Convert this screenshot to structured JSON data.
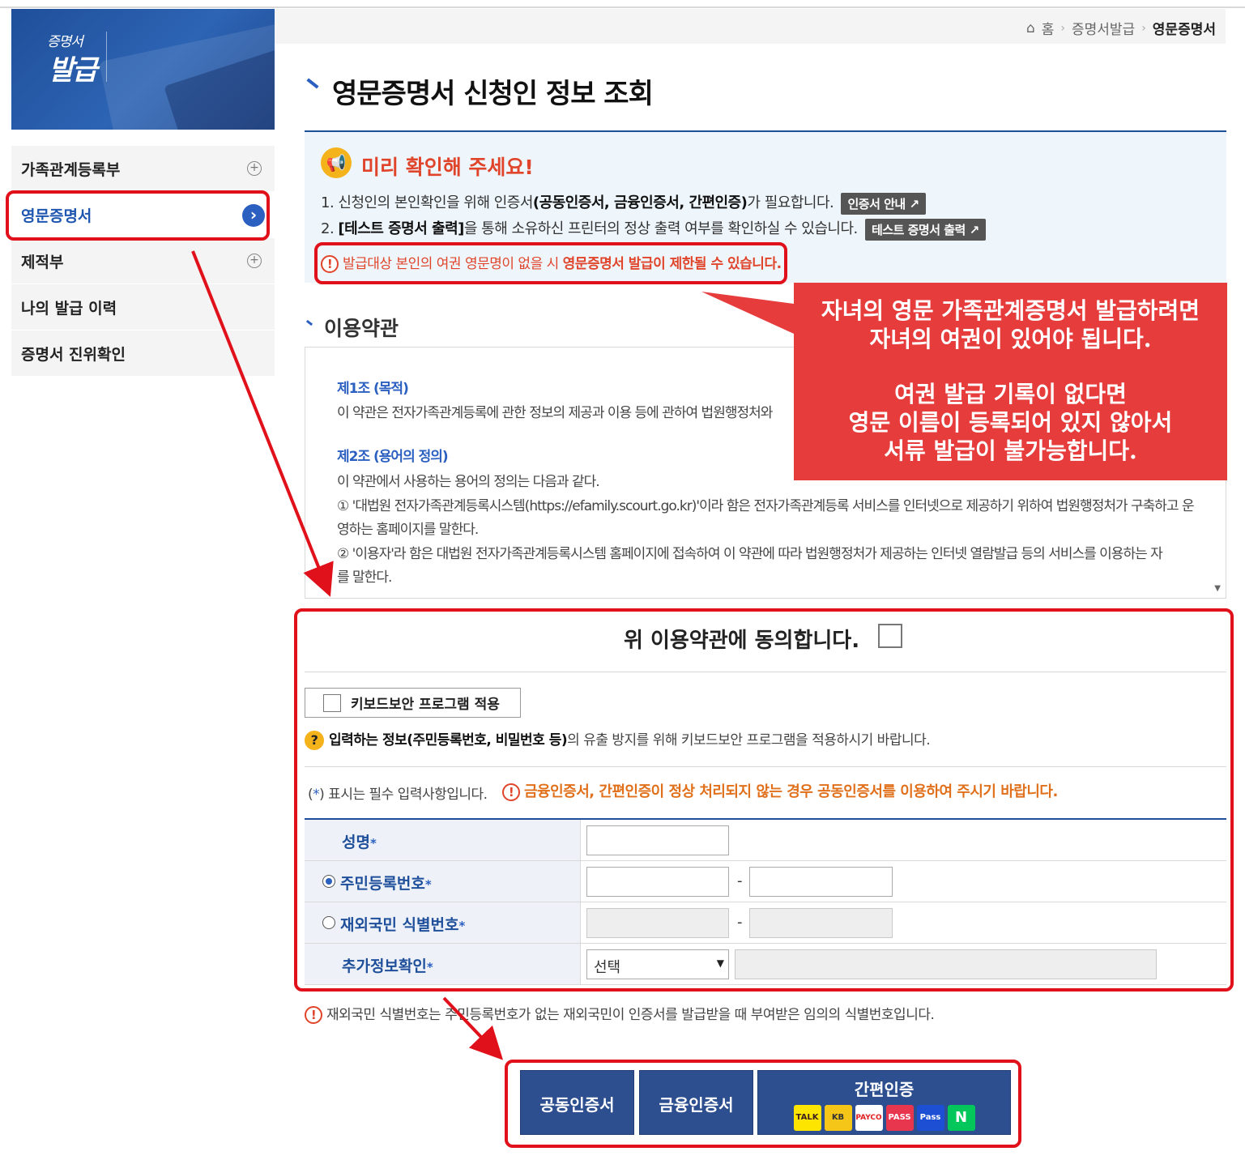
{
  "banner": {
    "small": "증명서",
    "big": "발급"
  },
  "sidebar": {
    "items": [
      {
        "label": "가족관계등록부"
      },
      {
        "label": "영문증명서"
      },
      {
        "label": "제적부"
      },
      {
        "label": "나의 발급 이력"
      },
      {
        "label": "증명서 진위확인"
      }
    ]
  },
  "breadcrumb": {
    "home": "홈",
    "level1": "증명서발급",
    "current": "영문증명서"
  },
  "page": {
    "title": "영문증명서 신청인 정보 조회"
  },
  "notice": {
    "heading": "미리 확인해 주세요!",
    "line1_a": "1. 신청인의 본인확인을 위해 인증서",
    "line1_b": "(공동인증서, 금융인증서, 간편인증)",
    "line1_c": "가 필요합니다.",
    "line1_btn": "인증서 안내",
    "line2_a": "2.",
    "line2_b": "[테스트 증명서 출력]",
    "line2_c": "을 통해 소유하신 프린터의 정상 출력 여부를 확인하실 수 있습니다.",
    "line2_btn": "테스트 증명서 출력",
    "warn_a": "발급대상 본인의 여권 영문명이 없을 시",
    "warn_b": "영문증명서 발급이 제한될 수 있습니다."
  },
  "callout": {
    "line1": "자녀의 영문 가족관계증명서 발급하려면",
    "line2": "자녀의 여권이 있어야 됩니다.",
    "line3": "여권 발급 기록이 없다면",
    "line4": "영문 이름이 등록되어 있지 않아서",
    "line5": "서류 발급이 불가능합니다."
  },
  "terms": {
    "title": "이용약관",
    "art1_title": "제1조 (목적)",
    "art1_text": "이 약관은 전자가족관계등록에 관한 정보의 제공과 이용 등에 관하여 법원행정처와 ",
    "art2_title": "제2조 (용어의 정의)",
    "art2_text": "이 약관에서 사용하는 용어의 정의는 다음과 같다.",
    "art2_item1a": "① '대법원 전자가족관계등록시스템(https://efamily.scourt.go.kr)'이라 함은 전자가족관계등록 서비스를 인터넷으로 제공하기 위하여 법원행정처가 구축하고 운",
    "art2_item1b": "영하는 홈페이지를 말한다.",
    "art2_item2a": "② '이용자'라 함은 대법원 전자가족관계등록시스템 홈페이지에 접속하여 이 약관에 따라 법원행정처가 제공하는 인터넷 열람발급 등의 서비스를 이용하는 자",
    "art2_item2b": "를 말한다."
  },
  "agree": {
    "label": "위 이용약관에 동의합니다."
  },
  "keyboard": {
    "label": "키보드보안 프로그램 적용",
    "note_b": "입력하는 정보(주민등록번호, 비밀번호 등)",
    "note_c": "의 유출 방지를 위해 키보드보안 프로그램을 적용하시기 바랍니다."
  },
  "required": {
    "open": "(",
    "star": "*",
    "close": ") 표시는 필수 입력사항입니다.",
    "fin_note": "금융인증서, 간편인증이 정상 처리되지 않는 경우 공동인증서를 이용하여 주시기 바랍니다."
  },
  "form": {
    "name_label": "성명",
    "rrn_label": "주민등록번호",
    "foreign_label": "재외국민 식별번호",
    "extra_label": "추가정보확인",
    "star": "*",
    "dash": "-",
    "select_value": "선택"
  },
  "bottom_note": "재외국민 식별번호는 주민등록번호가 없는 재외국민이 인증서를 발급받을 때 부여받은 임의의 식별번호입니다.",
  "buttons": {
    "joint": "공동인증서",
    "financial": "금융인증서",
    "simple": "간편인증",
    "simple_icons": [
      "TALK",
      "KB",
      "PAYCO",
      "PASS",
      "Pass",
      "N"
    ]
  },
  "colors": {
    "accent": "#2b5fc0",
    "navy": "#1f4f9a",
    "warning": "#e0452b",
    "highlight": "#e0111a",
    "button": "#2d4f8f"
  }
}
